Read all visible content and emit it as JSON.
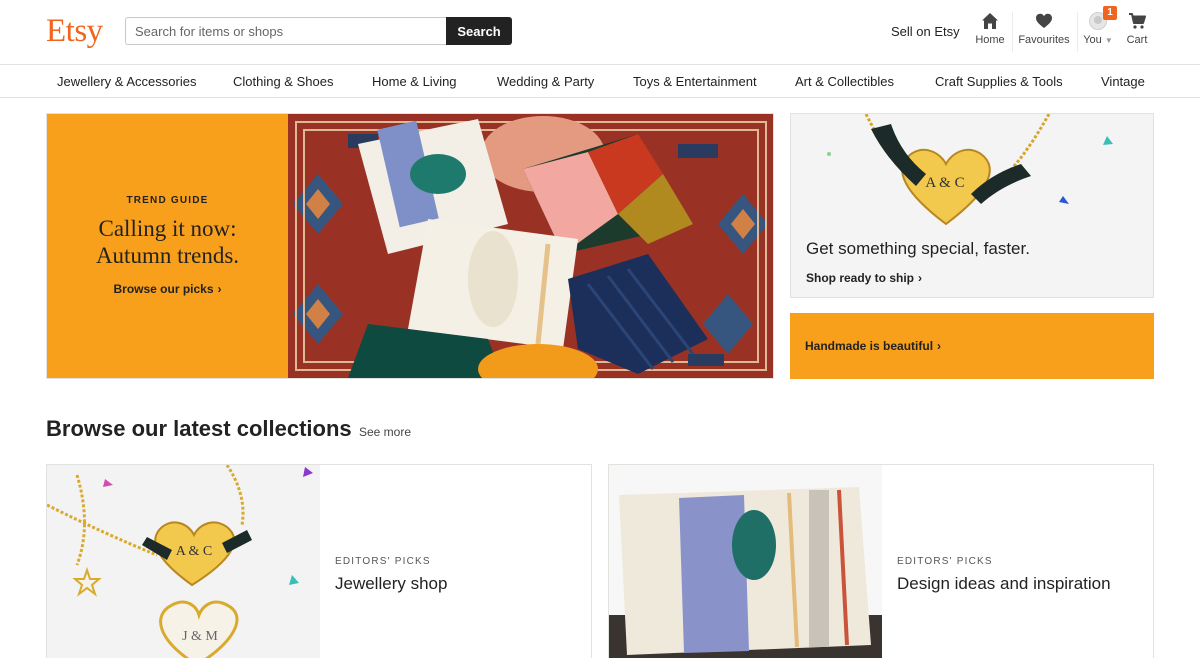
{
  "brand": {
    "logo": "Etsy",
    "accent": "#f1641e",
    "orange": "#f8a01b"
  },
  "search": {
    "placeholder": "Search for items or shops",
    "button": "Search"
  },
  "header": {
    "sell": "Sell on Etsy",
    "home": "Home",
    "favourites": "Favourites",
    "you": "You",
    "cart": "Cart",
    "notification_count": "1"
  },
  "categories": [
    "Jewellery & Accessories",
    "Clothing & Shoes",
    "Home & Living",
    "Wedding & Party",
    "Toys & Entertainment",
    "Art & Collectibles",
    "Craft Supplies & Tools",
    "Vintage"
  ],
  "hero": {
    "kicker": "TREND GUIDE",
    "title_line1": "Calling it now:",
    "title_line2": "Autumn trends.",
    "link": "Browse our picks",
    "chevron": "›"
  },
  "side_cards": {
    "special_title": "Get something special, faster.",
    "special_link": "Shop ready to ship",
    "handmade": "Handmade is beautiful",
    "necklace_text": "A & C"
  },
  "collections": {
    "title": "Browse our latest collections",
    "see_more": "See more",
    "items": [
      {
        "kicker": "EDITORS' PICKS",
        "title": "Jewellery shop",
        "engrave1": "A & C",
        "engrave2": "J & M"
      },
      {
        "kicker": "EDITORS' PICKS",
        "title": "Design ideas and inspiration"
      }
    ]
  },
  "icons": [
    "home-icon",
    "heart-icon",
    "avatar-icon",
    "caret-down-icon",
    "cart-icon",
    "chevron-right-icon"
  ]
}
